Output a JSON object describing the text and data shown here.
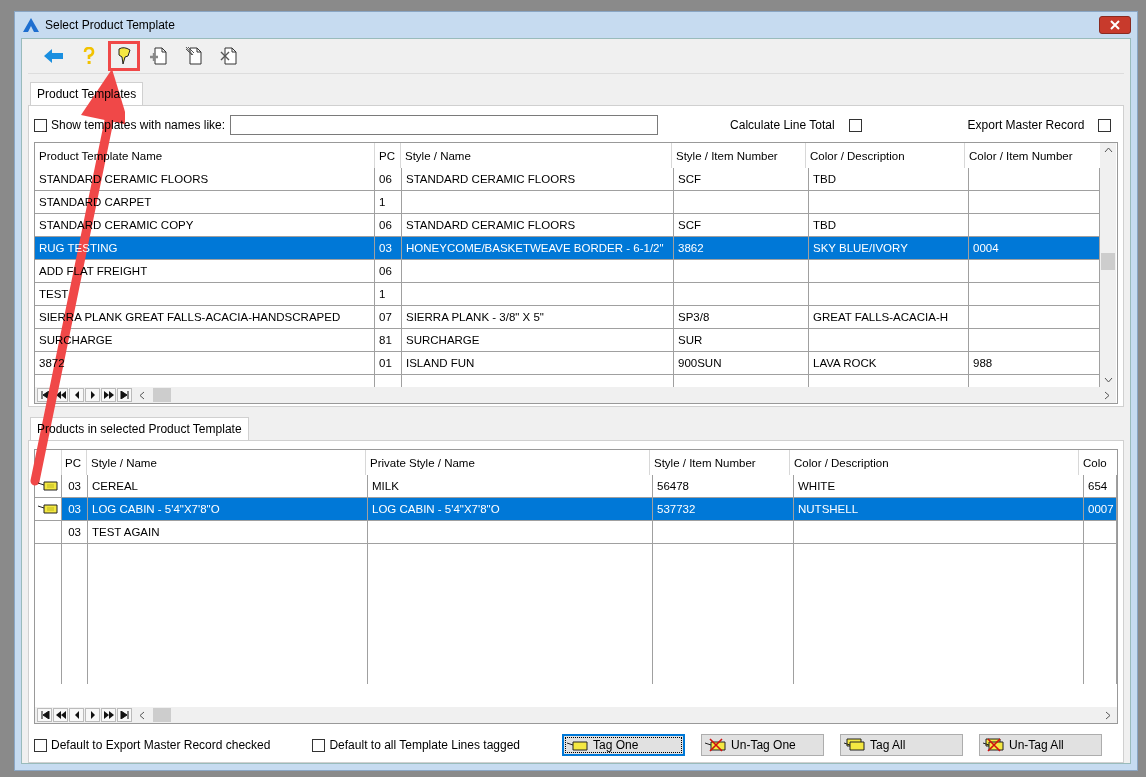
{
  "window": {
    "title": "Select Product Template"
  },
  "toolbar": [
    {
      "kind": "back",
      "highlighted": false
    },
    {
      "kind": "help",
      "highlighted": false
    },
    {
      "kind": "pin",
      "highlighted": true
    },
    {
      "kind": "add",
      "highlighted": false
    },
    {
      "kind": "edit",
      "highlighted": false
    },
    {
      "kind": "delete",
      "highlighted": false
    }
  ],
  "templates_tabs": [
    {
      "label": "Product Templates",
      "selected": true
    }
  ],
  "filter": {
    "label": "Show templates with names like:",
    "checked": false
  },
  "options": [
    {
      "label": "Calculate Line Total",
      "checked": false
    },
    {
      "label": "Export Master Record",
      "checked": false
    }
  ],
  "templates_table": {
    "columns": [
      "Product Template Name",
      "PC",
      "Style / Name",
      "Style / Item Number",
      "Color / Description",
      "Color / Item Number"
    ],
    "rows": [
      {
        "selected": false,
        "cells": [
          "STANDARD CERAMIC FLOORS",
          "06",
          "STANDARD CERAMIC FLOORS",
          "SCF",
          "TBD",
          ""
        ]
      },
      {
        "selected": false,
        "cells": [
          "STANDARD CARPET",
          "1",
          "",
          "",
          "",
          ""
        ]
      },
      {
        "selected": false,
        "cells": [
          "STANDARD CERAMIC COPY",
          "06",
          "STANDARD CERAMIC FLOORS",
          "SCF",
          "TBD",
          ""
        ]
      },
      {
        "selected": true,
        "cells": [
          "RUG TESTING",
          "03",
          "HONEYCOME/BASKETWEAVE BORDER - 6-1/2\"",
          "3862",
          "SKY BLUE/IVORY",
          "0004"
        ]
      },
      {
        "selected": false,
        "cells": [
          "ADD FLAT FREIGHT",
          "06",
          "",
          "",
          "",
          ""
        ]
      },
      {
        "selected": false,
        "cells": [
          "TEST",
          "1",
          "",
          "",
          "",
          ""
        ]
      },
      {
        "selected": false,
        "cells": [
          "SIERRA PLANK GREAT FALLS-ACACIA-HANDSCRAPED",
          "07",
          "SIERRA PLANK - 3/8\" X 5\"",
          "SP3/8",
          "GREAT FALLS-ACACIA-H",
          ""
        ]
      },
      {
        "selected": false,
        "cells": [
          "SURCHARGE",
          "81",
          "SURCHARGE",
          "SUR",
          "",
          ""
        ]
      },
      {
        "selected": false,
        "cells": [
          "3872",
          "01",
          "ISLAND FUN",
          "900SUN",
          "LAVA ROCK",
          "988"
        ]
      }
    ]
  },
  "products_tabs": [
    {
      "label": "Products in selected Product Template",
      "selected": true
    }
  ],
  "products_table": {
    "columns": [
      "PC",
      "Style / Name",
      "Private Style / Name",
      "Style / Item Number",
      "Color / Description",
      "Colo"
    ],
    "rows": [
      {
        "tagged": true,
        "selected": false,
        "cells": [
          "03",
          "CEREAL",
          "MILK",
          "56478",
          "WHITE",
          "654"
        ]
      },
      {
        "tagged": true,
        "selected": true,
        "cells": [
          "03",
          "LOG CABIN - 5'4\"X7'8\"O",
          "LOG CABIN - 5'4\"X7'8\"O",
          "537732",
          "NUTSHELL",
          "0007"
        ]
      },
      {
        "tagged": false,
        "selected": false,
        "cells": [
          "03",
          "TEST AGAIN",
          "",
          "",
          "",
          ""
        ]
      }
    ]
  },
  "defaults": [
    {
      "label": "Default to Export Master Record checked",
      "checked": false
    },
    {
      "label": "Default to all Template Lines tagged",
      "checked": false
    }
  ],
  "buttons": [
    {
      "kind": "tag",
      "label": "Tag One",
      "focused": true
    },
    {
      "kind": "untag",
      "label": "Un-Tag One",
      "focused": false
    },
    {
      "kind": "tag-all",
      "label": "Tag All",
      "focused": false
    },
    {
      "kind": "untag-all",
      "label": "Un-Tag All",
      "focused": false
    }
  ]
}
